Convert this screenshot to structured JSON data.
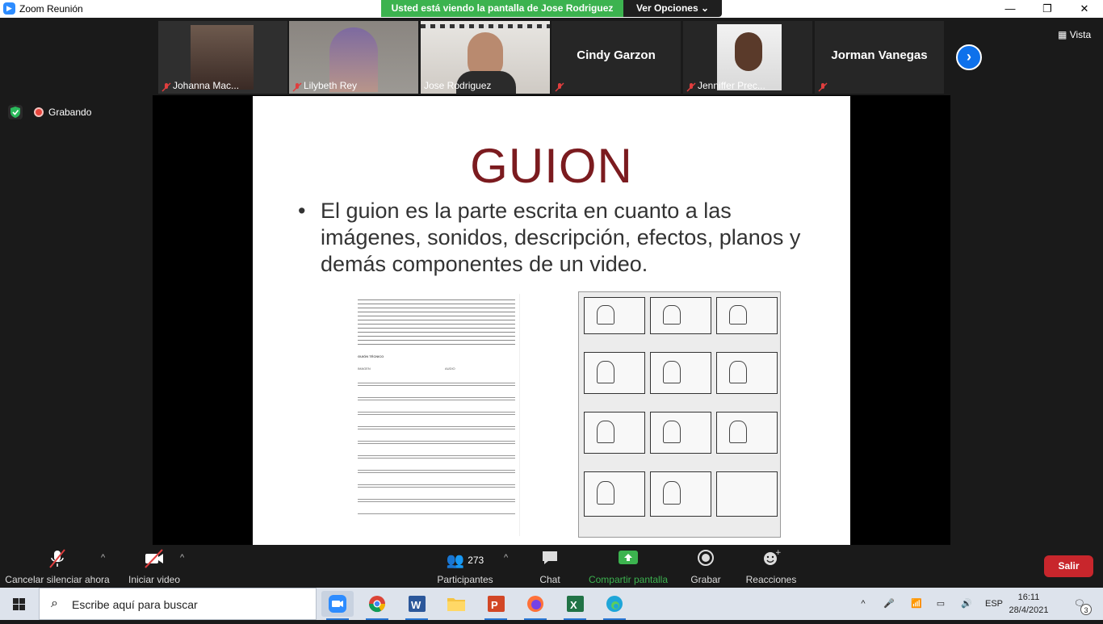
{
  "window": {
    "title": "Zoom Reunión",
    "viewing_banner": "Usted está viendo la pantalla de Jose Rodriguez",
    "view_options": "Ver Opciones",
    "view_label": "Vista"
  },
  "participants": [
    {
      "name": "Johanna Mac...",
      "muted": true
    },
    {
      "name": "Lilybeth Rey",
      "muted": true
    },
    {
      "name": "Jose Rodriguez",
      "muted": false,
      "active": true
    },
    {
      "name": "Cindy Garzon",
      "muted": true,
      "no_video": true
    },
    {
      "name": "Jenniffer Prec...",
      "muted": true
    },
    {
      "name": "Jorman Vanegas",
      "muted": true,
      "no_video": true
    }
  ],
  "status": {
    "recording": "Grabando"
  },
  "slide": {
    "title": "GUION",
    "bullet": "El guion es la parte escrita en cuanto a las imágenes, sonidos, descripción, efectos, planos y demás componentes de un video.",
    "doc_heading": "GUIÓN TÉCNICO",
    "doc_col_image": "IMAGEN",
    "doc_col_audio": "AUDIO"
  },
  "toolbar": {
    "unmute": "Cancelar silenciar ahora",
    "video": "Iniciar video",
    "participants": "Participantes",
    "participants_count": "273",
    "chat": "Chat",
    "share": "Compartir pantalla",
    "record": "Grabar",
    "reactions": "Reacciones",
    "leave": "Salir"
  },
  "taskbar": {
    "search_placeholder": "Escribe aquí para buscar",
    "language": "ESP",
    "time": "16:11",
    "date": "28/4/2021",
    "notifications": "3"
  },
  "colors": {
    "zoom_blue": "#2d8cff",
    "share_green": "#3cb34f",
    "leave_red": "#c8262c",
    "slide_title": "#7b1b1f"
  }
}
